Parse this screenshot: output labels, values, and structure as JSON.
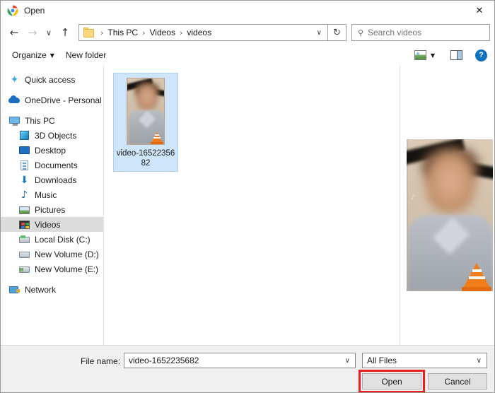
{
  "window": {
    "title": "Open",
    "app_icon": "chrome-logo-icon",
    "close_label": "✕"
  },
  "navbar": {
    "back_icon": "←",
    "forward_icon": "→",
    "recent_icon": "∨",
    "up_icon": "↑",
    "refresh_icon": "↻",
    "folder_icon": "folder-icon",
    "breadcrumb": [
      {
        "label": "This PC"
      },
      {
        "label": "Videos"
      },
      {
        "label": "videos"
      }
    ],
    "separator": "›",
    "dropdown_caret": "∨",
    "search": {
      "placeholder": "Search videos",
      "icon": "search-icon",
      "value": ""
    }
  },
  "toolbar": {
    "organize_label": "Organize",
    "organize_caret": "▼",
    "new_folder_label": "New folder",
    "view_caret": "▼",
    "help_label": "?"
  },
  "sidebar": {
    "items": [
      {
        "label": "Quick access",
        "icon": "star-icon",
        "indent": false,
        "selected": false
      },
      {
        "label": "OneDrive - Personal",
        "icon": "cloud-icon",
        "indent": false,
        "selected": false
      },
      {
        "label": "This PC",
        "icon": "monitor-icon",
        "indent": false,
        "selected": false
      },
      {
        "label": "3D Objects",
        "icon": "3d-objects-icon",
        "indent": true,
        "selected": false
      },
      {
        "label": "Desktop",
        "icon": "desktop-icon",
        "indent": true,
        "selected": false
      },
      {
        "label": "Documents",
        "icon": "documents-icon",
        "indent": true,
        "selected": false
      },
      {
        "label": "Downloads",
        "icon": "downloads-icon",
        "indent": true,
        "selected": false
      },
      {
        "label": "Music",
        "icon": "music-icon",
        "indent": true,
        "selected": false
      },
      {
        "label": "Pictures",
        "icon": "pictures-icon",
        "indent": true,
        "selected": false
      },
      {
        "label": "Videos",
        "icon": "videos-icon",
        "indent": true,
        "selected": true
      },
      {
        "label": "Local Disk (C:)",
        "icon": "drive-icon",
        "indent": true,
        "selected": false
      },
      {
        "label": "New Volume (D:)",
        "icon": "drive-icon",
        "indent": true,
        "selected": false
      },
      {
        "label": "New Volume (E:)",
        "icon": "drive-icon",
        "indent": true,
        "selected": false
      },
      {
        "label": "Network",
        "icon": "network-icon",
        "indent": false,
        "selected": false
      }
    ]
  },
  "files": [
    {
      "name": "video-1652235682",
      "selected": true,
      "overlay_icon": "vlc-cone-icon",
      "thumbnail": "blurred-person-video-thumbnail"
    }
  ],
  "preview": {
    "image": "blurred-person-video-preview",
    "overlay_icon": "vlc-cone-icon",
    "watermark": "♪"
  },
  "bottom": {
    "filename_label": "File name:",
    "filename_value": "video-1652235682",
    "filename_caret": "∨",
    "filetype_value": "All Files",
    "filetype_caret": "∨",
    "open_label": "Open",
    "cancel_label": "Cancel"
  },
  "annotation": {
    "highlight_color": "#ee1c1c",
    "target": "open-button"
  }
}
